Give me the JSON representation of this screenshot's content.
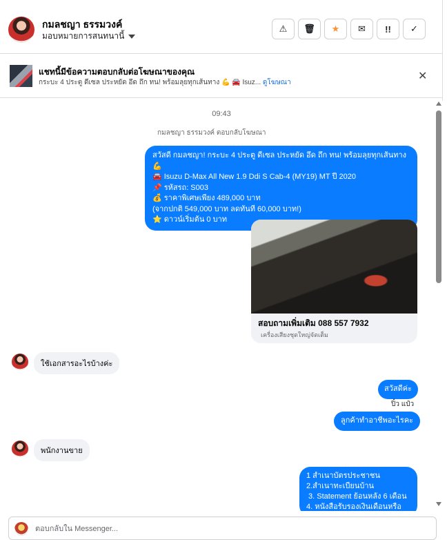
{
  "header": {
    "contact_name": "กมลชญา ธรรมวงค์",
    "assign_label": "มอบหมายการสนทนานี้",
    "actions": [
      {
        "icon": "warning-icon",
        "glyph": "⚠"
      },
      {
        "icon": "trash-icon",
        "glyph": "🗑"
      },
      {
        "icon": "star-icon",
        "glyph": "★"
      },
      {
        "icon": "mark-unread-icon",
        "glyph": "✉"
      },
      {
        "icon": "follow-up-icon",
        "glyph": "!!"
      },
      {
        "icon": "done-check-icon",
        "glyph": "✓"
      }
    ]
  },
  "banner": {
    "title": "แชทนี้มีข้อความตอบกลับต่อโฆษณาของคุณ",
    "subtitle": "กระบะ 4 ประตู ดีเซล ประหยัด อึด ถึก ทน! พร้อมลุยทุกเส้นทาง 💪 🚘 Isuz...",
    "link": "ดูโฆษณา"
  },
  "chat": {
    "time": "09:43",
    "reply_note": "กมลชญา ธรรมวงค์ ตอบกลับโฆษณา",
    "ad_message_lines": [
      "สวัสดี กมลชญา! กระบะ 4 ประตู ดีเซล ประหยัด อึด ถึก ทน! พร้อมลุยทุกเส้นทาง 💪",
      "🚘 Isuzu D-Max All New 1.9 Ddi S Cab-4 (MY19) MT ปี 2020",
      "📌 รหัสรถ: S003",
      "💰 ราคาพิเศษเพียง 489,000 บาท",
      "(จากปกติ 549,000 บาท ลดทันที 60,000 บาท!)",
      "⭐ ดาวน์เริ่มต้น 0 บาท"
    ],
    "card_title": "สอบถามเพิ่มเติม 088 557 7932",
    "card_subtitle": "เครื่องเสียงชุดใหญ่จัดเต็ม",
    "msg_in_1": "ใช้เอกสารอะไรบ้างค่ะ",
    "msg_out_1": "สวัสดีค่ะ",
    "sender_name": "ปิ๋ว แป๋ว",
    "msg_out_2": "ลูกค้าทำอาชีพอะไรคะ",
    "msg_in_2": "พนักงานขาย",
    "doc_list_lines": [
      "1 สำเนาบัตรประชาชน",
      "2.สำเนาทะเบียนบ้าน",
      " 3. Statement ย้อนหลัง 6 เดือน",
      "4. หนังสือรับรองเงินเดือนหรือ"
    ]
  },
  "composer": {
    "placeholder": "ตอบกลับใน Messenger..."
  }
}
